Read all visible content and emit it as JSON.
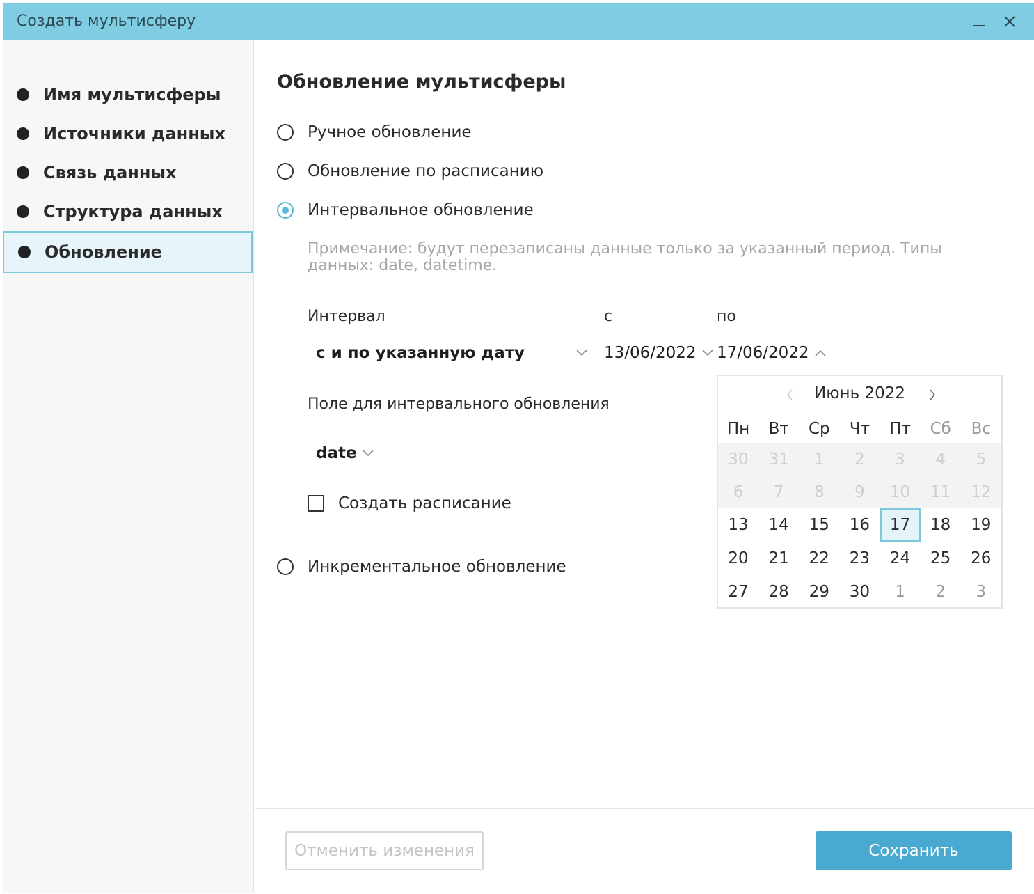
{
  "window": {
    "title": "Создать мультисферу",
    "minimize_icon": "minimize-icon",
    "close_icon": "close-icon"
  },
  "sidebar": {
    "items": [
      {
        "label": "Имя мультисферы",
        "active": false
      },
      {
        "label": "Источники данных",
        "active": false
      },
      {
        "label": "Связь данных",
        "active": false
      },
      {
        "label": "Структура данных",
        "active": false
      },
      {
        "label": "Обновление",
        "active": true
      }
    ]
  },
  "main": {
    "title": "Обновление мультисферы",
    "options": [
      {
        "label": "Ручное обновление",
        "checked": false
      },
      {
        "label": "Обновление по расписанию",
        "checked": false
      },
      {
        "label": "Интервальное обновление",
        "checked": true
      },
      {
        "label": "Инкрементальное обновление",
        "checked": false
      }
    ],
    "note": "Примечание: будут перезаписаны данные только за указанный период. Типы данных: date, datetime.",
    "interval": {
      "label": "Интервал",
      "value": "с и по указанную дату",
      "from_label": "с",
      "from_value": "13/06/2022",
      "to_label": "по",
      "to_value": "17/06/2022"
    },
    "field": {
      "label": "Поле для интервального обновления",
      "value": "date"
    },
    "schedule_checkbox": {
      "label": "Создать расписание",
      "checked": false
    }
  },
  "calendar": {
    "month_label": "Июнь 2022",
    "weekdays": [
      "Пн",
      "Вт",
      "Ср",
      "Чт",
      "Пт",
      "Сб",
      "Вс"
    ],
    "weeks": [
      [
        "30",
        "31",
        "1",
        "2",
        "3",
        "4",
        "5"
      ],
      [
        "6",
        "7",
        "8",
        "9",
        "10",
        "11",
        "12"
      ],
      [
        "13",
        "14",
        "15",
        "16",
        "17",
        "18",
        "19"
      ],
      [
        "20",
        "21",
        "22",
        "23",
        "24",
        "25",
        "26"
      ],
      [
        "27",
        "28",
        "29",
        "30",
        "1",
        "2",
        "3"
      ]
    ],
    "selected_day": "17"
  },
  "footer": {
    "cancel_label": "Отменить изменения",
    "save_label": "Сохранить"
  },
  "colors": {
    "titlebar": "#80cde3",
    "accent": "#5ab7d4",
    "save_button": "#4aa9d1",
    "active_item_bg": "#e7f5fa"
  }
}
